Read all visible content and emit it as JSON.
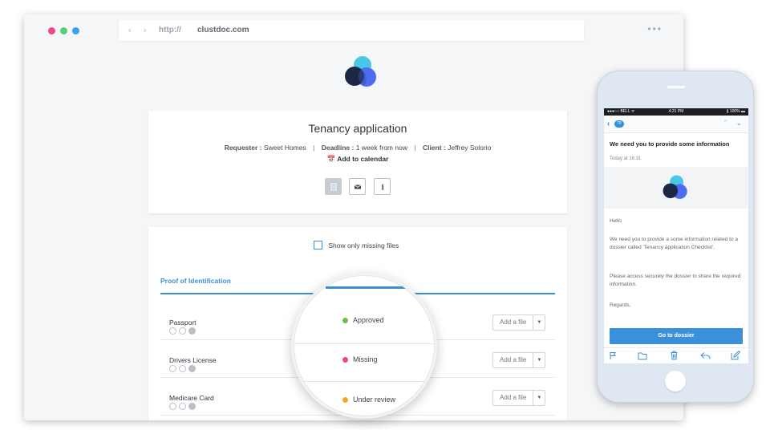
{
  "browser": {
    "nav_arrows": "‹ ›",
    "protocol": "http://",
    "domain": "clustdoc.com",
    "menu_dots": "•••"
  },
  "header": {
    "title": "Tenancy application",
    "requester_label": "Requester :",
    "requester_value": "Sweet Homes",
    "deadline_label": "Deadline :",
    "deadline_value": "1 week from now",
    "client_label": "Client :",
    "client_value": "Jeffrey Solorio",
    "separator": "|",
    "add_calendar": "Add to calendar"
  },
  "files": {
    "show_missing_label": "Show only missing files",
    "section_tab": "Proof of Identification",
    "add_file_label": "Add a file",
    "caret": "▼",
    "rows": [
      {
        "name": "Passport",
        "status": "Approved",
        "status_color": "#6cc04a"
      },
      {
        "name": "Drivers License",
        "status": "Missing",
        "status_color": "#f0476b"
      },
      {
        "name": "Medicare Card",
        "status": "Under review",
        "status_color": "#f5a623"
      }
    ]
  },
  "phone": {
    "status_left": "●●●○○ BELL ᯤ",
    "status_time": "4:21 PM",
    "status_right": "∦ 100% ▬",
    "back_badge": "79",
    "subject": "We need you to provide some information",
    "time": "Today at 16:31",
    "greeting": "Hello",
    "paragraph1": "We need you to provide a some information related to a dossier called 'Tenancy application Checklist'.",
    "paragraph2": "Please access securely the dossier to share the required information.",
    "signoff": "Regards,",
    "cta": "Go to dossier"
  },
  "colors": {
    "accent": "#3b8fd6",
    "approved": "#6cc04a",
    "missing": "#f0476b",
    "review": "#f5a623"
  }
}
